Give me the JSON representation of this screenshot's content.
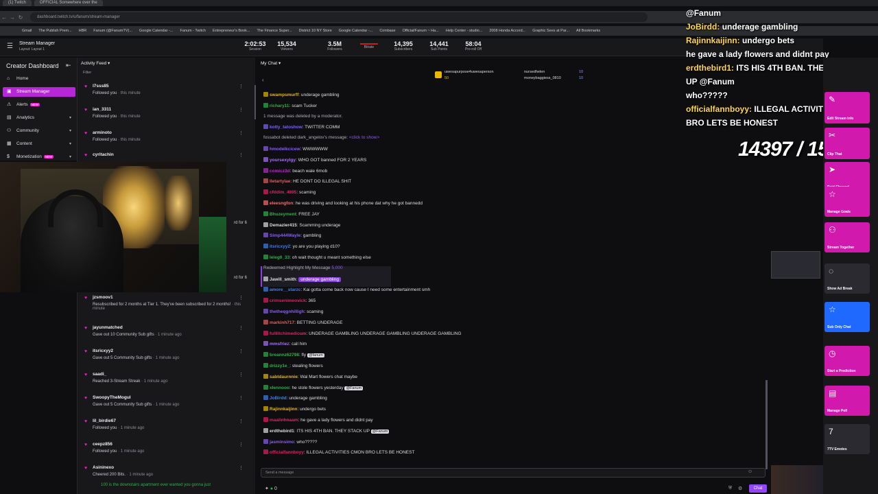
{
  "browser": {
    "tabs": [
      "(1) Twitch",
      "OFFICIAL Somewhere over the"
    ],
    "url": "dashboard.twitch.tv/u/fanum/stream-manager",
    "bookmarks": [
      "Gmail",
      "The Publish Prem...",
      "HBR",
      "Fanum (@FanumTV)...",
      "Google Calendar -...",
      "Fanum - Twitch",
      "Entrepreneur's Book...",
      "The Finance Super...",
      "District 10 NY Store",
      "Google Calendar -...",
      "Coinbase",
      "Official/Fanum ~ Ha...",
      "Help Center - studio...",
      "2008 Honda Accord...",
      "Graphic Sees at Par...",
      "All Bookmarks"
    ]
  },
  "topbar": {
    "title": "Stream Manager",
    "subtitle": "Layout: Layout 1",
    "stats": [
      {
        "value": "2:02:53",
        "label": "Session"
      },
      {
        "value": "15,534",
        "label": "Viewers"
      },
      {
        "value": "3.5M",
        "label": "Followers"
      },
      {
        "value": "",
        "label": "Bitrate"
      },
      {
        "value": "14,395",
        "label": "Subscribers"
      },
      {
        "value": "14,441",
        "label": "Sub Points"
      },
      {
        "value": "58:04",
        "label": "Pre-roll Off"
      }
    ]
  },
  "leftnav": {
    "title": "Creator Dashboard",
    "items": [
      {
        "label": "Home",
        "icon": "home-icon"
      },
      {
        "label": "Stream Manager",
        "icon": "stream-icon"
      },
      {
        "label": "Alerts",
        "icon": "alert-icon",
        "badge": "NEW"
      },
      {
        "label": "Analytics",
        "icon": "chart-icon"
      },
      {
        "label": "Community",
        "icon": "community-icon"
      },
      {
        "label": "Content",
        "icon": "content-icon"
      },
      {
        "label": "Monetization",
        "icon": "money-icon",
        "badge": "NEW"
      }
    ]
  },
  "activity": {
    "title": "Activity Feed",
    "filter": "Filter",
    "items": [
      {
        "name": "l7sss85",
        "desc": "Followed you",
        "time": "· this minute"
      },
      {
        "name": "ian_3311",
        "desc": "Followed you",
        "time": "· this minute"
      },
      {
        "name": "arminoto",
        "desc": "Followed you",
        "time": "· this minute"
      },
      {
        "name": "cyritachin",
        "desc": "",
        "time": ""
      },
      {
        "name": "jzsmoov1",
        "desc": "Resubscribed for 2 months at Tier 1. They've been subscribed for 2 months!",
        "time": "· this minute"
      },
      {
        "name": "jayunmatched",
        "desc": "Gave out 10 Community Sub gifts",
        "time": "· 1 minute ago"
      },
      {
        "name": "itsricxyy2",
        "desc": "Gave out 5 Community Sub gifts",
        "time": "· 1 minute ago"
      },
      {
        "name": "saadi_",
        "desc": "Reached 3-Stream Streak",
        "time": "· 1 minute ago"
      },
      {
        "name": "SwoopyTheMogul",
        "desc": "Gave out 5 Community Sub gifts",
        "time": "· 1 minute ago"
      },
      {
        "name": "lil_birdie67",
        "desc": "Followed you",
        "time": "· 1 minute ago"
      },
      {
        "name": "ceepz856",
        "desc": "Followed you",
        "time": "· 1 minute ago"
      },
      {
        "name": "Asininexo",
        "desc": "Cheered 200 Bits.",
        "time": "· 1 minute ago"
      }
    ],
    "cheer_msg": "100 is the downstairs apartment ever wanted you gonna just",
    "cam_overlay": [
      "rd for 6",
      "rd for 6"
    ]
  },
  "chat": {
    "title": "My Chat",
    "pinned": [
      "uwesapurpose4uwesaperson",
      "nursedhelen",
      "moneybaggiess_0810"
    ],
    "pinned_counts": [
      "50",
      "10",
      "10"
    ],
    "messages": [
      {
        "user": "swampsmurff",
        "color": "#e6b800",
        "text": "underage gambling"
      },
      {
        "user": "richary11",
        "color": "#29b34a",
        "text": "scam Tucker"
      },
      {
        "sys": "1 message was deleted by a moderator."
      },
      {
        "user": "kotty_tatoshow",
        "color": "#7a64ff",
        "text": "TWITTER COMM"
      },
      {
        "sys": "fossabot deleted dark_angelov's message:",
        "cta": "<click to show>"
      },
      {
        "user": "hmodelkcicew",
        "color": "#8b5cf6",
        "text": "WWWWWW"
      },
      {
        "user": "yoursexylgy",
        "color": "#a970ff",
        "text": "WHO GOT banned FOR 2 YEARS"
      },
      {
        "user": "comicz3d",
        "color": "#c026d3",
        "text": "beach wale 6mob"
      },
      {
        "user": "lletartylae",
        "color": "#e85d5d",
        "text": "HE DONT DO ILLEGAL SHIT"
      },
      {
        "user": "cfddim_4895",
        "color": "#e91e63",
        "text": "scaming"
      },
      {
        "user": "eleesngfon",
        "color": "#ff6b6b",
        "text": "he was driving and looking at his phone dat why he got bannedd"
      },
      {
        "user": "Bhuzeyment",
        "color": "#29b34a",
        "text": "FREE JAY"
      },
      {
        "user": "Demazier415",
        "color": "#dedee3",
        "text": "Scamming underage"
      },
      {
        "user": "Simp444Wayle",
        "color": "#8b5cf6",
        "text": "gambling"
      },
      {
        "user": "itsricxyy2",
        "color": "#3b82f6",
        "text": "yo are you playing d10?"
      },
      {
        "user": "leleg0_33",
        "color": "#29b34a",
        "text": "oh wait thought u meant something else"
      },
      {
        "sys": "Redeemed Highlight My Message",
        "cta": "5,000"
      },
      {
        "user": "Jawill_smith",
        "color": "#dedee3",
        "text": "underage gambling",
        "hl": true
      },
      {
        "user": "amore__starzc",
        "color": "#3b82f6",
        "text": "Kai gotta come back now cause I need some entertainment smh"
      },
      {
        "user": "crimsenimeovick",
        "color": "#e91e63",
        "text": "365"
      },
      {
        "user": "thetheqgnhilligh",
        "color": "#8b5cf6",
        "text": "scaming"
      },
      {
        "user": "markinh717",
        "color": "#e85d5d",
        "text": "BETTING UNDERAGE"
      },
      {
        "user": "fulllitchimedicum",
        "color": "#e91e63",
        "text": "UNDERAGE GAMBLING UNDERAGE GAMBLING UNDERAGE GAMBLING"
      },
      {
        "user": "mmsfriez",
        "color": "#a970ff",
        "text": "call him"
      },
      {
        "user": "breannz62798",
        "color": "#29b34a",
        "text": "fly",
        "mention": "@fanum"
      },
      {
        "user": "drizzy1e_",
        "color": "#29b34a",
        "text": "stealing flowers"
      },
      {
        "user": "sabtdaurnnie",
        "color": "#e6b800",
        "text": "Wal Mart flowers chat maybe"
      },
      {
        "user": "xlennooo",
        "color": "#29b34a",
        "text": "he stole flowers yesterday",
        "mention": "@Fanum"
      },
      {
        "user": "JoBirdd",
        "color": "#3b82f6",
        "text": "underage gambling"
      },
      {
        "user": "Rajinnkaijinn",
        "color": "#e6b800",
        "text": "undergo bets"
      },
      {
        "user": "maalinhnaam",
        "color": "#e91e63",
        "text": "he gave a lady flowers and didnt pay"
      },
      {
        "user": "erdthebird1",
        "color": "#dedee3",
        "text": "ITS HIS 4TH BAN. THEY STACK UP",
        "mention": "@Fanum"
      },
      {
        "user": "jasminsimo",
        "color": "#8b5cf6",
        "text": "who?????"
      },
      {
        "user": "officialfannboyy",
        "color": "#e91e63",
        "text": "ILLEGAL ACTIVITIES CMON BRO LETS BE HONEST"
      }
    ],
    "input_placeholder": "Send a message",
    "chat_button": "Chat",
    "points": "0"
  },
  "overlay": {
    "lines": [
      {
        "user": "",
        "text": "@Fanum"
      },
      {
        "user": "JoBirdd:",
        "text": "underage gambling"
      },
      {
        "user": "Rajinnkaijinn:",
        "text": "undergo bets"
      },
      {
        "user": "",
        "text": "he gave a lady flowers and didnt pay"
      },
      {
        "user": "erdthebird1:",
        "text": "ITS HIS 4TH BAN. THEY STACK UP @Fanum"
      },
      {
        "user": "",
        "text": "who?????"
      },
      {
        "user": "officialfannboyy:",
        "text": "ILLEGAL ACTIVITIES CMON BRO LETS BE HONEST"
      }
    ],
    "goal": "14397 / 15,000"
  },
  "quick_actions": [
    {
      "label": "Edit Stream Info",
      "icon": "edit-icon",
      "color": "pink"
    },
    {
      "label": "Clip That",
      "icon": "clip-icon",
      "color": "pink"
    },
    {
      "label": "Raid Channel",
      "icon": "raid-icon",
      "color": "pink"
    },
    {
      "label": "Manage Goals",
      "icon": "star-icon",
      "color": "pink"
    },
    {
      "label": "Stream Together",
      "icon": "together-icon",
      "color": "pink"
    },
    {
      "label": "Show Ad Break",
      "icon": "ad-icon",
      "color": "grey"
    },
    {
      "label": "Sub Only Chat",
      "icon": "star-icon",
      "color": "blue"
    },
    {
      "label": "Start a Prediction",
      "icon": "prediction-icon",
      "color": "pink"
    },
    {
      "label": "Manage Poll",
      "icon": "poll-icon",
      "color": "pink"
    },
    {
      "label": "7TV Emotes",
      "icon": "7tv-icon",
      "color": "grey"
    }
  ]
}
